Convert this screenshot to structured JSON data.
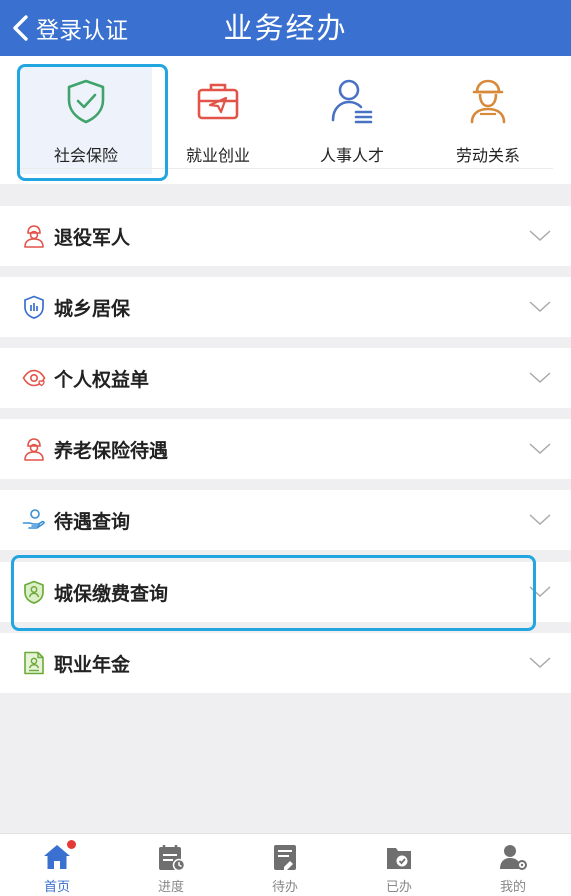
{
  "header": {
    "back_label": "登录认证",
    "title": "业务经办"
  },
  "categories": [
    {
      "label": "社会保险",
      "icon": "shield-check-icon"
    },
    {
      "label": "就业创业",
      "icon": "briefcase-icon"
    },
    {
      "label": "人事人才",
      "icon": "person-list-icon"
    },
    {
      "label": "劳动关系",
      "icon": "worker-icon"
    }
  ],
  "menu": [
    {
      "label": "退役军人",
      "icon": "soldier-icon"
    },
    {
      "label": "城乡居保",
      "icon": "shield-chart-icon"
    },
    {
      "label": "个人权益单",
      "icon": "eye-heart-icon"
    },
    {
      "label": "养老保险待遇",
      "icon": "soldier-icon"
    },
    {
      "label": "待遇查询",
      "icon": "hand-coin-icon"
    },
    {
      "label": "城保缴费查询",
      "icon": "shield-person-icon"
    },
    {
      "label": "职业年金",
      "icon": "document-person-icon"
    }
  ],
  "tabbar": [
    {
      "label": "首页",
      "icon": "home-icon",
      "active": true
    },
    {
      "label": "进度",
      "icon": "calendar-list-icon"
    },
    {
      "label": "待办",
      "icon": "todo-doc-icon"
    },
    {
      "label": "已办",
      "icon": "done-folder-icon"
    },
    {
      "label": "我的",
      "icon": "user-icon"
    }
  ],
  "colors": {
    "header": "#3a70cf",
    "highlight": "#23a6e0",
    "tab_active": "#3a70cf"
  }
}
